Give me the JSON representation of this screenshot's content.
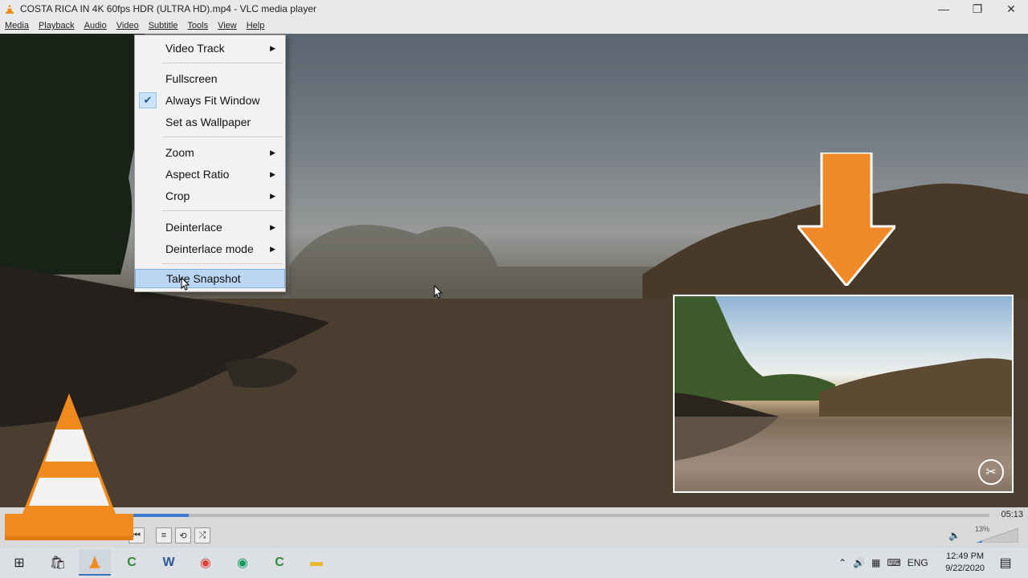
{
  "window": {
    "title": "COSTA RICA IN 4K 60fps HDR (ULTRA HD).mp4 - VLC media player",
    "minimize_glyph": "—",
    "restore_glyph": "❐",
    "close_glyph": "✕"
  },
  "menubar": {
    "items": [
      "Media",
      "Playback",
      "Audio",
      "Video",
      "Subtitle",
      "Tools",
      "View",
      "Help"
    ]
  },
  "context_menu": {
    "items": [
      {
        "label": "Video Track",
        "submenu": true
      },
      {
        "label": "Fullscreen",
        "submenu": false
      },
      {
        "label": "Always Fit Window",
        "checked": true
      },
      {
        "label": "Set as Wallpaper",
        "submenu": false
      },
      {
        "label": "Zoom",
        "submenu": true
      },
      {
        "label": "Aspect Ratio",
        "submenu": true
      },
      {
        "label": "Crop",
        "submenu": true
      },
      {
        "label": "Deinterlace",
        "submenu": true
      },
      {
        "label": "Deinterlace mode",
        "submenu": true
      },
      {
        "label": "Take Snapshot",
        "highlighted": true
      }
    ],
    "check_glyph": "✔",
    "submenu_glyph": "▶"
  },
  "player": {
    "elapsed_fraction": 0.07,
    "time_label": "05:13",
    "volume_label": "13%",
    "controls": [
      "⏮",
      "≡",
      "⟲",
      "⤮"
    ]
  },
  "taskbar": {
    "time": "12:49 PM",
    "date": "9/22/2020",
    "language": "ENG",
    "start_glyph": "⊞"
  },
  "colors": {
    "vlc_orange": "#f08a1c",
    "arrow_orange": "#f08a28",
    "highlight": "#b9d6f2"
  }
}
